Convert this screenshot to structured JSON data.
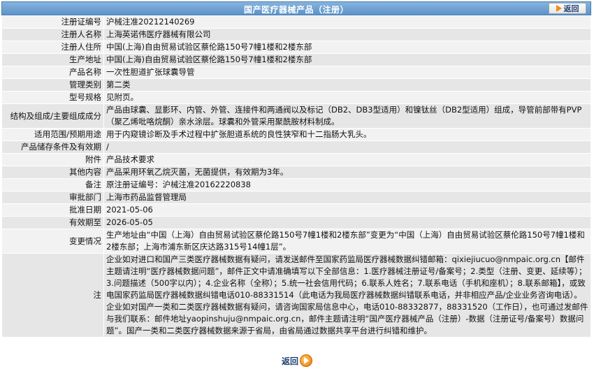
{
  "header": {
    "title": "国产医疗器械产品（注册）",
    "back_label": "返回"
  },
  "rows": [
    {
      "label": "注册证编号",
      "value": "沪械注准20212140269"
    },
    {
      "label": "注册人名称",
      "value": "上海英诺伟医疗器械有限公司"
    },
    {
      "label": "注册人住所",
      "value": "中国(上海)自由贸易试验区蔡伦路150号7幢1楼和2楼东部"
    },
    {
      "label": "生产地址",
      "value": "中国(上海)自由贸易试验区蔡伦路150号7幢1楼和2楼东部"
    },
    {
      "label": "产品名称",
      "value": "一次性胆道扩张球囊导管"
    },
    {
      "label": "管理类别",
      "value": "第二类"
    },
    {
      "label": "型号规格",
      "value": "见附页。"
    },
    {
      "label": "结构及组成/主要组成成分",
      "value": "产品由球囊、显影环、内管、外管、连接件和两通阀以及标记（DB2、DB3型适用）和镍钛丝（DB2型适用）组成，导管前部带有PVP（聚乙烯吡咯烷酮）亲水涂层。球囊和外管采用聚酰胺材料制成。"
    },
    {
      "label": "适用范围/预期用途",
      "value": "用于内窥镜诊断及手术过程中扩张胆道系统的良性狭窄和十二指肠大乳头。"
    },
    {
      "label": "产品储存条件及有效期",
      "value": "/"
    },
    {
      "label": "附件",
      "value": "产品技术要求"
    },
    {
      "label": "其他内容",
      "value": "产品采用环氧乙烷灭菌，无菌提供，有效期为3年。"
    },
    {
      "label": "备注",
      "value": "原注册证编号：沪械注准20162220838"
    },
    {
      "label": "审批部门",
      "value": "上海市药品监督管理局"
    },
    {
      "label": "批准日期",
      "value": "2021-05-06"
    },
    {
      "label": "有效期至",
      "value": "2026-05-05"
    },
    {
      "label": "变更情况",
      "value": "生产地址由“中国（上海）自由贸易试验区蔡伦路150号7幢1楼和2楼东部”变更为“中国（上海）自由贸易试验区蔡伦路150号7幢1楼和2楼东部；上海市浦东新区庆达路315号14幢1层”。"
    },
    {
      "label": "注",
      "value": "企业如对进口和国产三类医疗器械数据有疑问，请发送邮件至国家药监局医疗器械数据纠错邮箱：qixiejiucuo@nmpaic.org.cn【邮件主题请注明“医疗器械数据问题”，邮件正文中请准确填写以下全部信息：1.医疗器械注册证号/备案号；2.类型（注册、变更、延续等）；3.问题描述（500字以内）；4.企业名称（全称）；5.统一社会信用代码；6.联系人姓名；7.联系电话（手机和座机）；8.联系邮箱】，或致电国家药监局医疗器械数据纠错电话010-88331514（此电话为我局医疗器械数据纠错联系电话，并非相应产品/企业业务咨询电话）。企业如对国产一类和二类医疗器械数据有疑问，请咨询国家局信息中心，电话010-88332877，88331520（工作日），也可通过发邮件与我们联系：邮件地址yaopinshuju@nmpaic.org.cn，邮件主题请注明“国产医疗器械产品（注册）-数据（注册证号/备案号）数据问题”。国产一类和二类医疗器械数据来源于省局，由省局通过数据共享平台进行纠错和维护。"
    }
  ],
  "footer": {
    "back_label": "返回"
  },
  "colors": {
    "header_bg": "#6a9fd2",
    "row_odd": "#f2f2f2",
    "row_even": "#e6e6e6",
    "accent": "#f08c1a"
  },
  "icons": {
    "back_top": "arrow-right-icon",
    "back_bottom": "circle-arrow-icon"
  }
}
